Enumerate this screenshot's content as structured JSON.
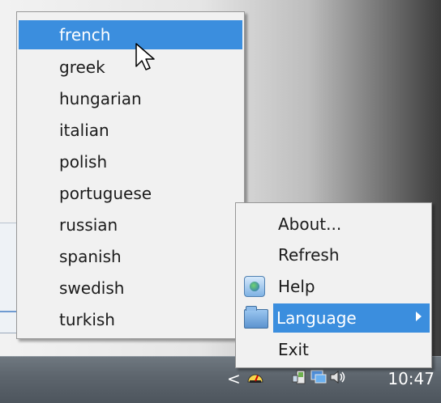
{
  "language_submenu": {
    "items": [
      {
        "label": "french",
        "selected": true
      },
      {
        "label": "greek"
      },
      {
        "label": "hungarian"
      },
      {
        "label": "italian"
      },
      {
        "label": "polish"
      },
      {
        "label": "portuguese"
      },
      {
        "label": "russian"
      },
      {
        "label": "spanish"
      },
      {
        "label": "swedish"
      },
      {
        "label": "turkish"
      }
    ]
  },
  "context_menu": {
    "items": [
      {
        "label": "About..."
      },
      {
        "label": "Refresh"
      },
      {
        "label": "Help",
        "icon": "help-icon"
      },
      {
        "label": "Language",
        "icon": "folder-icon",
        "selected": true,
        "has_submenu": true
      },
      {
        "label": "Exit"
      }
    ]
  },
  "taskbar": {
    "clock": "10:47",
    "show_hidden_icons": "<",
    "tray_icons": [
      "speedometer-icon",
      "network-icon",
      "monitor-icon",
      "volume-icon"
    ]
  },
  "colors": {
    "selection": "#3b8ede",
    "menu_bg": "#f1f1f1",
    "taskbar": "#5e666e"
  }
}
